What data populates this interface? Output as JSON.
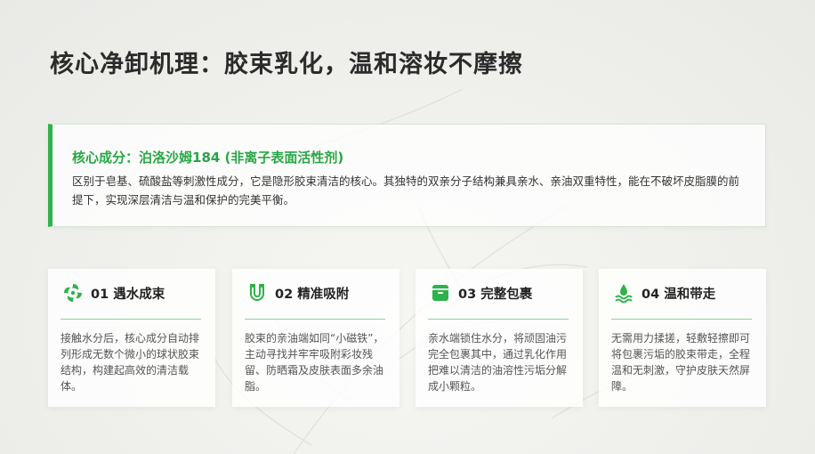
{
  "title": "核心净卸机理：胶束乳化，温和溶妆不摩擦",
  "core": {
    "heading": "核心成分：泊洛沙姆184 (非离子表面活性剂)",
    "description": "区别于皂基、硫酸盐等刺激性成分，它是隐形胶束清洁的核心。其独特的双亲分子结构兼具亲水、亲油双重特性，能在不破坏皮脂膜的前提下，实现深层清洁与温和保护的完美平衡。"
  },
  "cards": [
    {
      "title": "01 遇水成束",
      "icon": "swirl-icon",
      "text": "接触水分后，核心成分自动排列形成无数个微小的球状胶束结构，构建起高效的清洁载体。"
    },
    {
      "title": "02 精准吸附",
      "icon": "magnet-icon",
      "text": "胶束的亲油端如同“小磁铁”，主动寻找并牢牢吸附彩妆残留、防晒霜及皮肤表面多余油脂。"
    },
    {
      "title": "03 完整包裹",
      "icon": "box-icon",
      "text": "亲水端锁住水分，将顽固油污完全包裹其中，通过乳化作用把难以清洁的油溶性污垢分解成小颗粒。"
    },
    {
      "title": "04 温和带走",
      "icon": "water-drop-icon",
      "text": "无需用力揉搓，轻敷轻擦即可将包裹污垢的胶束带走，全程温和无刺激，守护皮肤天然屏障。"
    }
  ],
  "colors": {
    "accent": "#2db34a",
    "title": "#2b2b2b"
  }
}
